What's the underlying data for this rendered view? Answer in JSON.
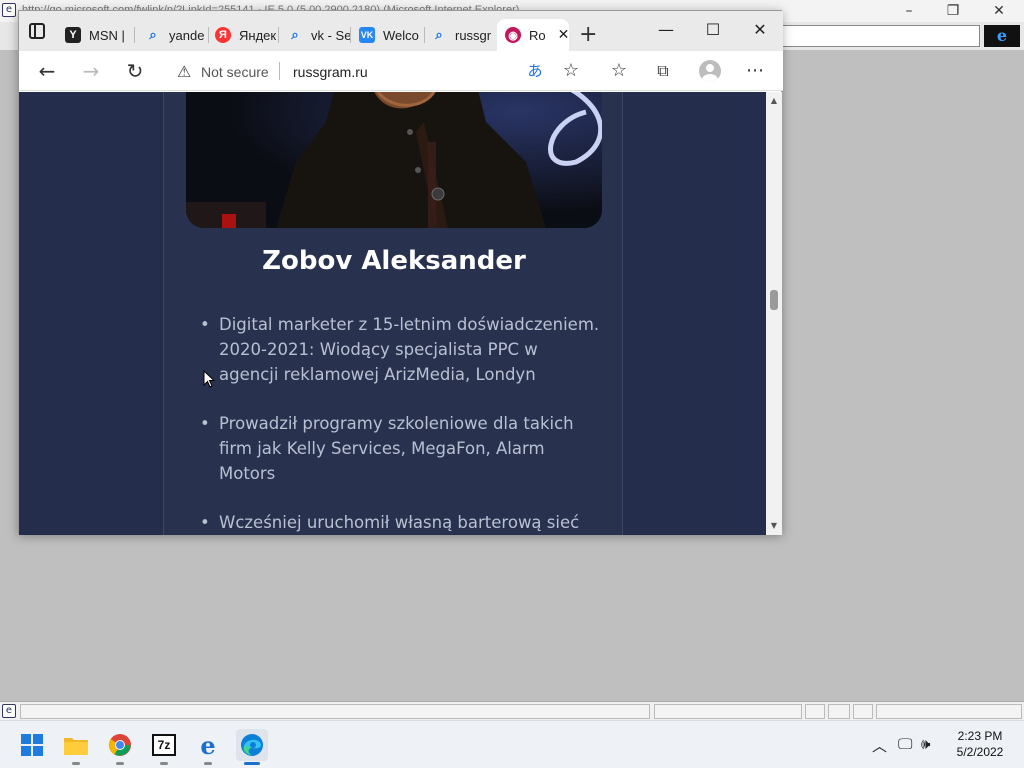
{
  "ie_window": {
    "title": "http://go.microsoft.com/fwlink/p/?LinkId=255141 - IE 5.0 (5.00.2900.2180) (Microsoft Internet Explorer)"
  },
  "edge": {
    "tabs": [
      {
        "label": "MSN |",
        "favicon": "msn-icon"
      },
      {
        "label": "yande",
        "favicon": "search-icon"
      },
      {
        "label": "Яндек",
        "favicon": "yandex-icon"
      },
      {
        "label": "vk - Se",
        "favicon": "search-icon"
      },
      {
        "label": "Welco",
        "favicon": "vk-icon"
      },
      {
        "label": "russgr",
        "favicon": "search-icon"
      },
      {
        "label": "Ro",
        "favicon": "russgram-icon"
      }
    ],
    "address": {
      "security_label": "Not secure",
      "url": "russgram.ru"
    }
  },
  "page": {
    "profile_name": "Zobov Aleksander",
    "bio": [
      "Digital marketer z 15-letnim doświadczeniem. 2020-2021: Wiodący specjalista PPC w agencji reklamowej ArizMedia, Londyn",
      "Prowadził programy szkoleniowe dla takich firm jak Kelly Services, MegaFon, Alarm Motors",
      "Wcześniej uruchomił własną barterową sieć"
    ]
  },
  "taskbar": {
    "apps": [
      "start-icon",
      "file-explorer-icon",
      "chrome-icon",
      "7zip-icon",
      "internet-explorer-icon",
      "edge-icon"
    ],
    "sevenzip_label": "7z",
    "clock_time": "2:23 PM",
    "clock_date": "5/2/2022"
  }
}
